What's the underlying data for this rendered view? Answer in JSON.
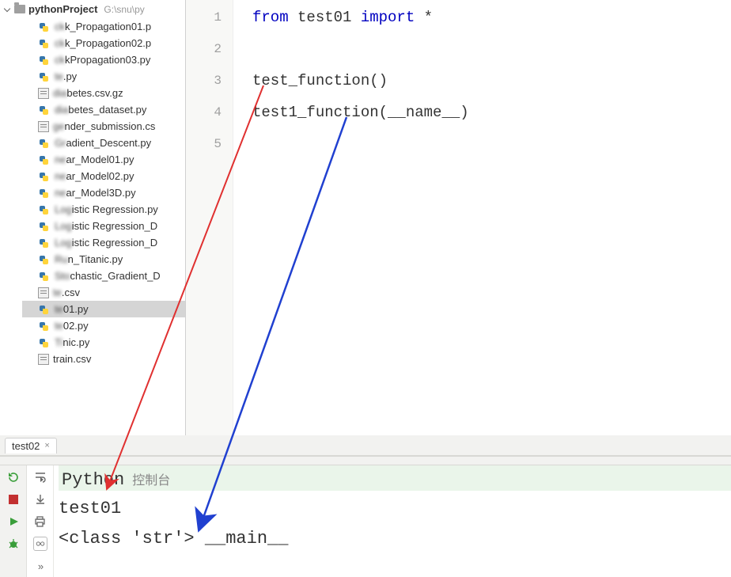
{
  "project": {
    "name": "pythonProject",
    "path": "G:\\snu\\py"
  },
  "files": [
    {
      "type": "py",
      "label_pre": "",
      "label_blur": "ck",
      "label": "k_Propagation01.p"
    },
    {
      "type": "py",
      "label_pre": "",
      "label_blur": "ck",
      "label": "k_Propagation02.p"
    },
    {
      "type": "py",
      "label_pre": "",
      "label_blur": "ck",
      "label": "kPropagation03.py"
    },
    {
      "type": "py",
      "label_pre": "",
      "label_blur": "te",
      "label": ".py"
    },
    {
      "type": "txt",
      "label_pre": "",
      "label_blur": "dia",
      "label": "betes.csv.gz"
    },
    {
      "type": "py",
      "label_pre": "",
      "label_blur": "dia",
      "label": "betes_dataset.py"
    },
    {
      "type": "txt",
      "label_pre": "",
      "label_blur": "ge",
      "label": "nder_submission.cs"
    },
    {
      "type": "py",
      "label_pre": "",
      "label_blur": "Gr",
      "label": "adient_Descent.py"
    },
    {
      "type": "py",
      "label_pre": "",
      "label_blur": "ne",
      "label": "ar_Model01.py"
    },
    {
      "type": "py",
      "label_pre": "",
      "label_blur": "ne",
      "label": "ar_Model02.py"
    },
    {
      "type": "py",
      "label_pre": "",
      "label_blur": "ne",
      "label": "ar_Model3D.py"
    },
    {
      "type": "py",
      "label_pre": "",
      "label_blur": "Log",
      "label": "istic Regression.py"
    },
    {
      "type": "py",
      "label_pre": "",
      "label_blur": "Log",
      "label": "istic Regression_D"
    },
    {
      "type": "py",
      "label_pre": "",
      "label_blur": "Log",
      "label": "istic Regression_D"
    },
    {
      "type": "py",
      "label_pre": "",
      "label_blur": "Ru",
      "label": "n_Titanic.py"
    },
    {
      "type": "py",
      "label_pre": "",
      "label_blur": "Sto",
      "label": "chastic_Gradient_D"
    },
    {
      "type": "txt",
      "label_pre": "",
      "label_blur": "te",
      "label": ".csv"
    },
    {
      "type": "py",
      "label_pre": "",
      "label_blur": "te",
      "label": "01.py",
      "selected": true
    },
    {
      "type": "py",
      "label_pre": "",
      "label_blur": "te",
      "label": "02.py"
    },
    {
      "type": "py",
      "label_pre": "",
      "label_blur": "Ti",
      "label": "nic.py"
    },
    {
      "type": "txt",
      "label_pre": "",
      "label_blur": "",
      "label": "train.csv"
    }
  ],
  "code": {
    "ln1": "1",
    "ln2": "2",
    "ln3": "3",
    "ln4": "4",
    "ln5": "5",
    "kw_from": "from",
    "mod": " test01 ",
    "kw_import": "import",
    "star": " *",
    "line3": "test_function()",
    "line4": "test1_function(__name__)"
  },
  "tab": {
    "label": "test02",
    "close": "×"
  },
  "console": {
    "title": "Python",
    "sub": "控制台",
    "out1": "test01",
    "out2": "<class 'str'> __main__"
  }
}
